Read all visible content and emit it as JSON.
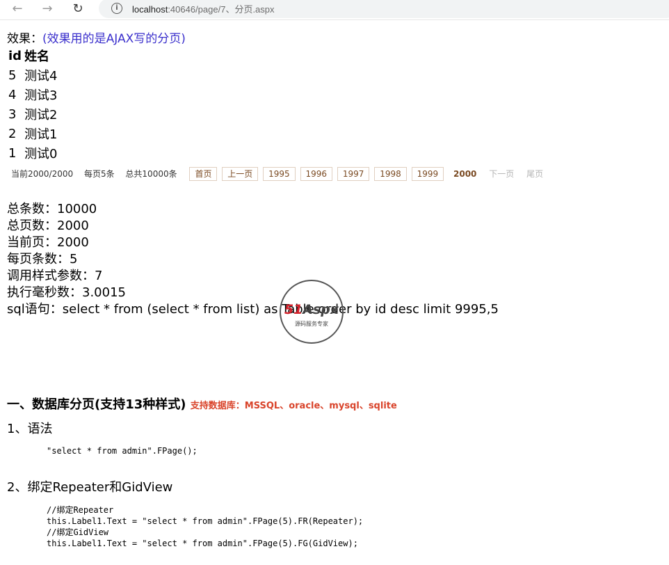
{
  "browser": {
    "url_host": "localhost",
    "url_path": ":40646/page/7、分页.aspx"
  },
  "effect": {
    "label": "效果：",
    "note": "(效果用的是AJAX写的分页)"
  },
  "table": {
    "headers": [
      "id",
      "姓名"
    ],
    "rows": [
      [
        "5",
        "测试4"
      ],
      [
        "4",
        "测试3"
      ],
      [
        "3",
        "测试2"
      ],
      [
        "2",
        "测试1"
      ],
      [
        "1",
        "测试0"
      ]
    ]
  },
  "pager": {
    "current_text": "当前2000/2000",
    "per_page_text": "每页5条",
    "total_text": "总共10000条",
    "first": "首页",
    "prev": "上一页",
    "pages": [
      "1995",
      "1996",
      "1997",
      "1998",
      "1999"
    ],
    "current": "2000",
    "next": "下一页",
    "last": "尾页"
  },
  "stats": [
    "总条数：10000",
    "总页数：2000",
    "当前页：2000",
    "每页条数：5",
    "调用样式参数：7",
    "执行毫秒数：3.0015",
    "sql语句：select * from (select * from list) as Table order by id desc limit 9995,5"
  ],
  "watermark": {
    "logo_red": "51",
    "logo_rest": "Aspx",
    "sub": "源码服务专家"
  },
  "section": {
    "title": "一、数据库分页(支持13种样式)",
    "supported": "支持数据库：MSSQL、oracle、mysql、sqlite"
  },
  "syntax": {
    "title": "1、语法",
    "code": "\"select * from admin\".FPage();"
  },
  "bind": {
    "title": "2、绑定Repeater和GidView",
    "code": "//绑定Repeater\nthis.Label1.Text = \"select * from admin\".FPage(5).FR(Repeater);\n//绑定GidView\nthis.Label1.Text = \"select * from admin\".FPage(5).FG(GidView);"
  }
}
